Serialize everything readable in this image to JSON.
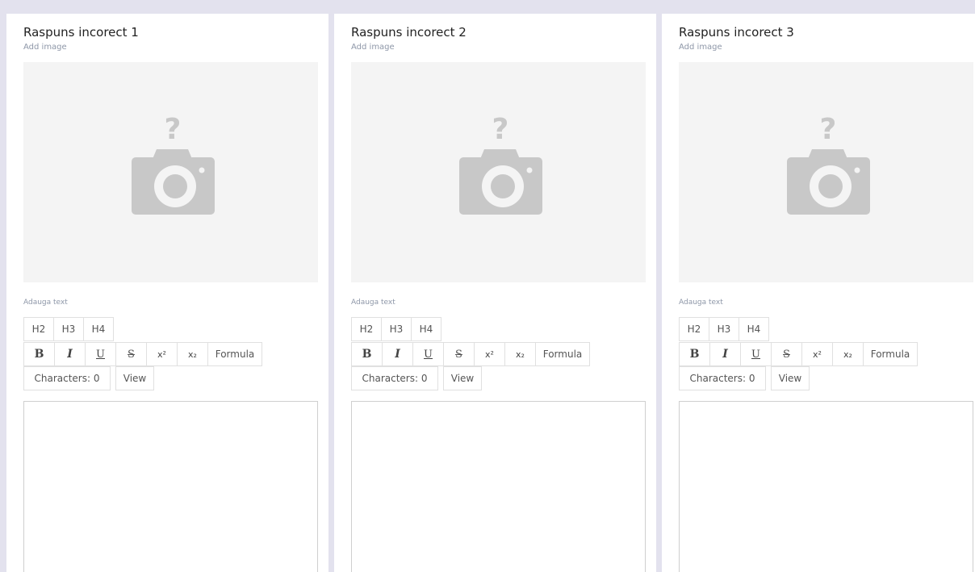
{
  "cards": [
    {
      "title": "Raspuns incorect 1",
      "add_image_label": "Add image",
      "text_label": "Adauga text",
      "toolbar": {
        "h2": "H2",
        "h3": "H3",
        "h4": "H4",
        "bold": "B",
        "italic": "I",
        "underline": "U",
        "strike": "S",
        "superscript": "x²",
        "subscript": "x₂",
        "formula": "Formula",
        "characters": "Characters: 0",
        "view": "View"
      },
      "editor_value": ""
    },
    {
      "title": "Raspuns incorect 2",
      "add_image_label": "Add image",
      "text_label": "Adauga text",
      "toolbar": {
        "h2": "H2",
        "h3": "H3",
        "h4": "H4",
        "bold": "B",
        "italic": "I",
        "underline": "U",
        "strike": "S",
        "superscript": "x²",
        "subscript": "x₂",
        "formula": "Formula",
        "characters": "Characters: 0",
        "view": "View"
      },
      "editor_value": ""
    },
    {
      "title": "Raspuns incorect 3",
      "add_image_label": "Add image",
      "text_label": "Adauga text",
      "toolbar": {
        "h2": "H2",
        "h3": "H3",
        "h4": "H4",
        "bold": "B",
        "italic": "I",
        "underline": "U",
        "strike": "S",
        "superscript": "x²",
        "subscript": "x₂",
        "formula": "Formula",
        "characters": "Characters: 0",
        "view": "View"
      },
      "editor_value": ""
    }
  ],
  "placeholder_icon": "camera-question-icon",
  "colors": {
    "page_background": "#e3e2ee",
    "card_background": "#ffffff",
    "placeholder_background": "#f4f4f4",
    "icon_gray": "#c8c8c8",
    "label_gray": "#8e97a8"
  }
}
